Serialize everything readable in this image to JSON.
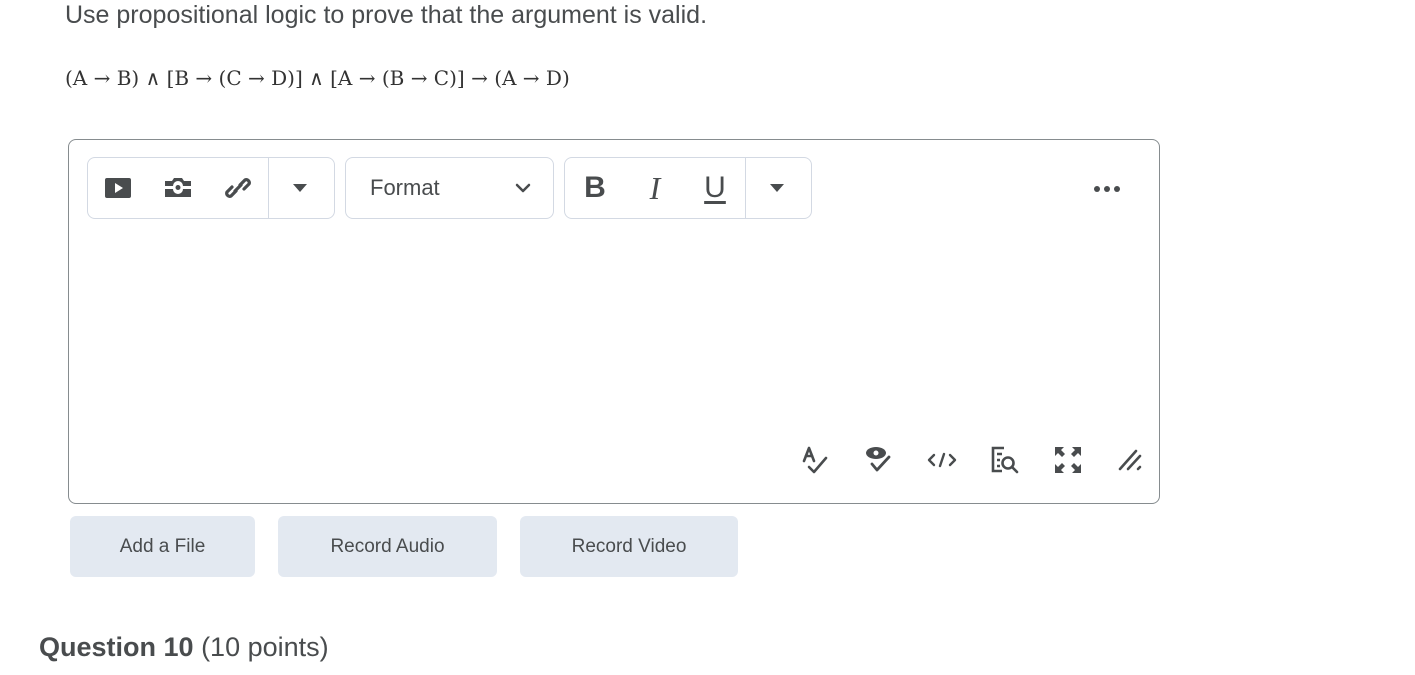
{
  "question": {
    "prompt": "Use propositional logic to prove that the argument is valid.",
    "formula": "(A → B) ∧ [B → (C → D)] ∧ [A → (B → C)] → (A → D)"
  },
  "editor": {
    "toolbar": {
      "insert_group": [
        {
          "icon": "video-icon",
          "label": "Insert Video"
        },
        {
          "icon": "camera-icon",
          "label": "Insert Image"
        },
        {
          "icon": "link-icon",
          "label": "Insert Link"
        }
      ],
      "format_select": {
        "value": "Format"
      },
      "text_group": [
        {
          "icon": "bold-icon",
          "glyph": "B"
        },
        {
          "icon": "italic-icon",
          "glyph": "I"
        },
        {
          "icon": "underline-icon",
          "glyph": "U"
        }
      ],
      "more_label": "•••"
    },
    "content": "",
    "bottom_tools": [
      "spellcheck-icon",
      "accessibility-check-icon",
      "source-code-icon",
      "preview-icon",
      "fullscreen-icon",
      "resize-handle-icon"
    ]
  },
  "actions": {
    "add_file": "Add a File",
    "record_audio": "Record Audio",
    "record_video": "Record Video"
  },
  "next_question": {
    "title": "Question 10",
    "points": "(10 points)"
  }
}
